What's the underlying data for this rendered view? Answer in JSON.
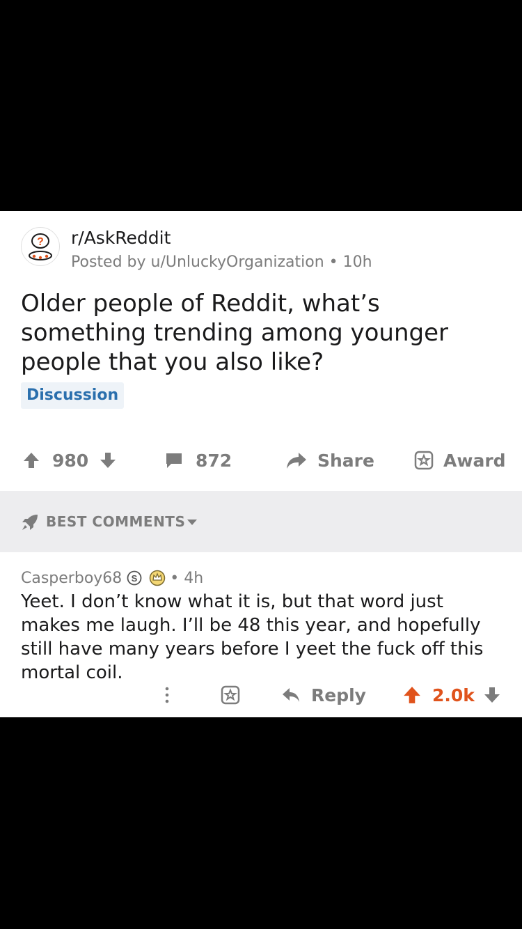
{
  "post": {
    "subreddit": "r/AskReddit",
    "posted_by": "Posted by u/UnluckyOrganization • 10h",
    "title": "Older people of Reddit, what’s something trending among younger people that you also like?",
    "flair": "Discussion",
    "upvotes": "980",
    "comments": "872",
    "share_label": "Share",
    "award_label": "Award"
  },
  "sort": {
    "label": "BEST COMMENTS"
  },
  "comment": {
    "author": "Casperboy68",
    "time": "• 4h",
    "body": "Yeet. I don’t know what it is, but that word just makes me laugh. I’ll be 48 this year, and hopefully still have many years before I yeet the fuck off this mortal coil.",
    "reply_label": "Reply",
    "score": "2.0k"
  },
  "colors": {
    "upvoted": "#e0531c",
    "flair_text": "#2a6fad",
    "muted": "#7c7c7c"
  }
}
